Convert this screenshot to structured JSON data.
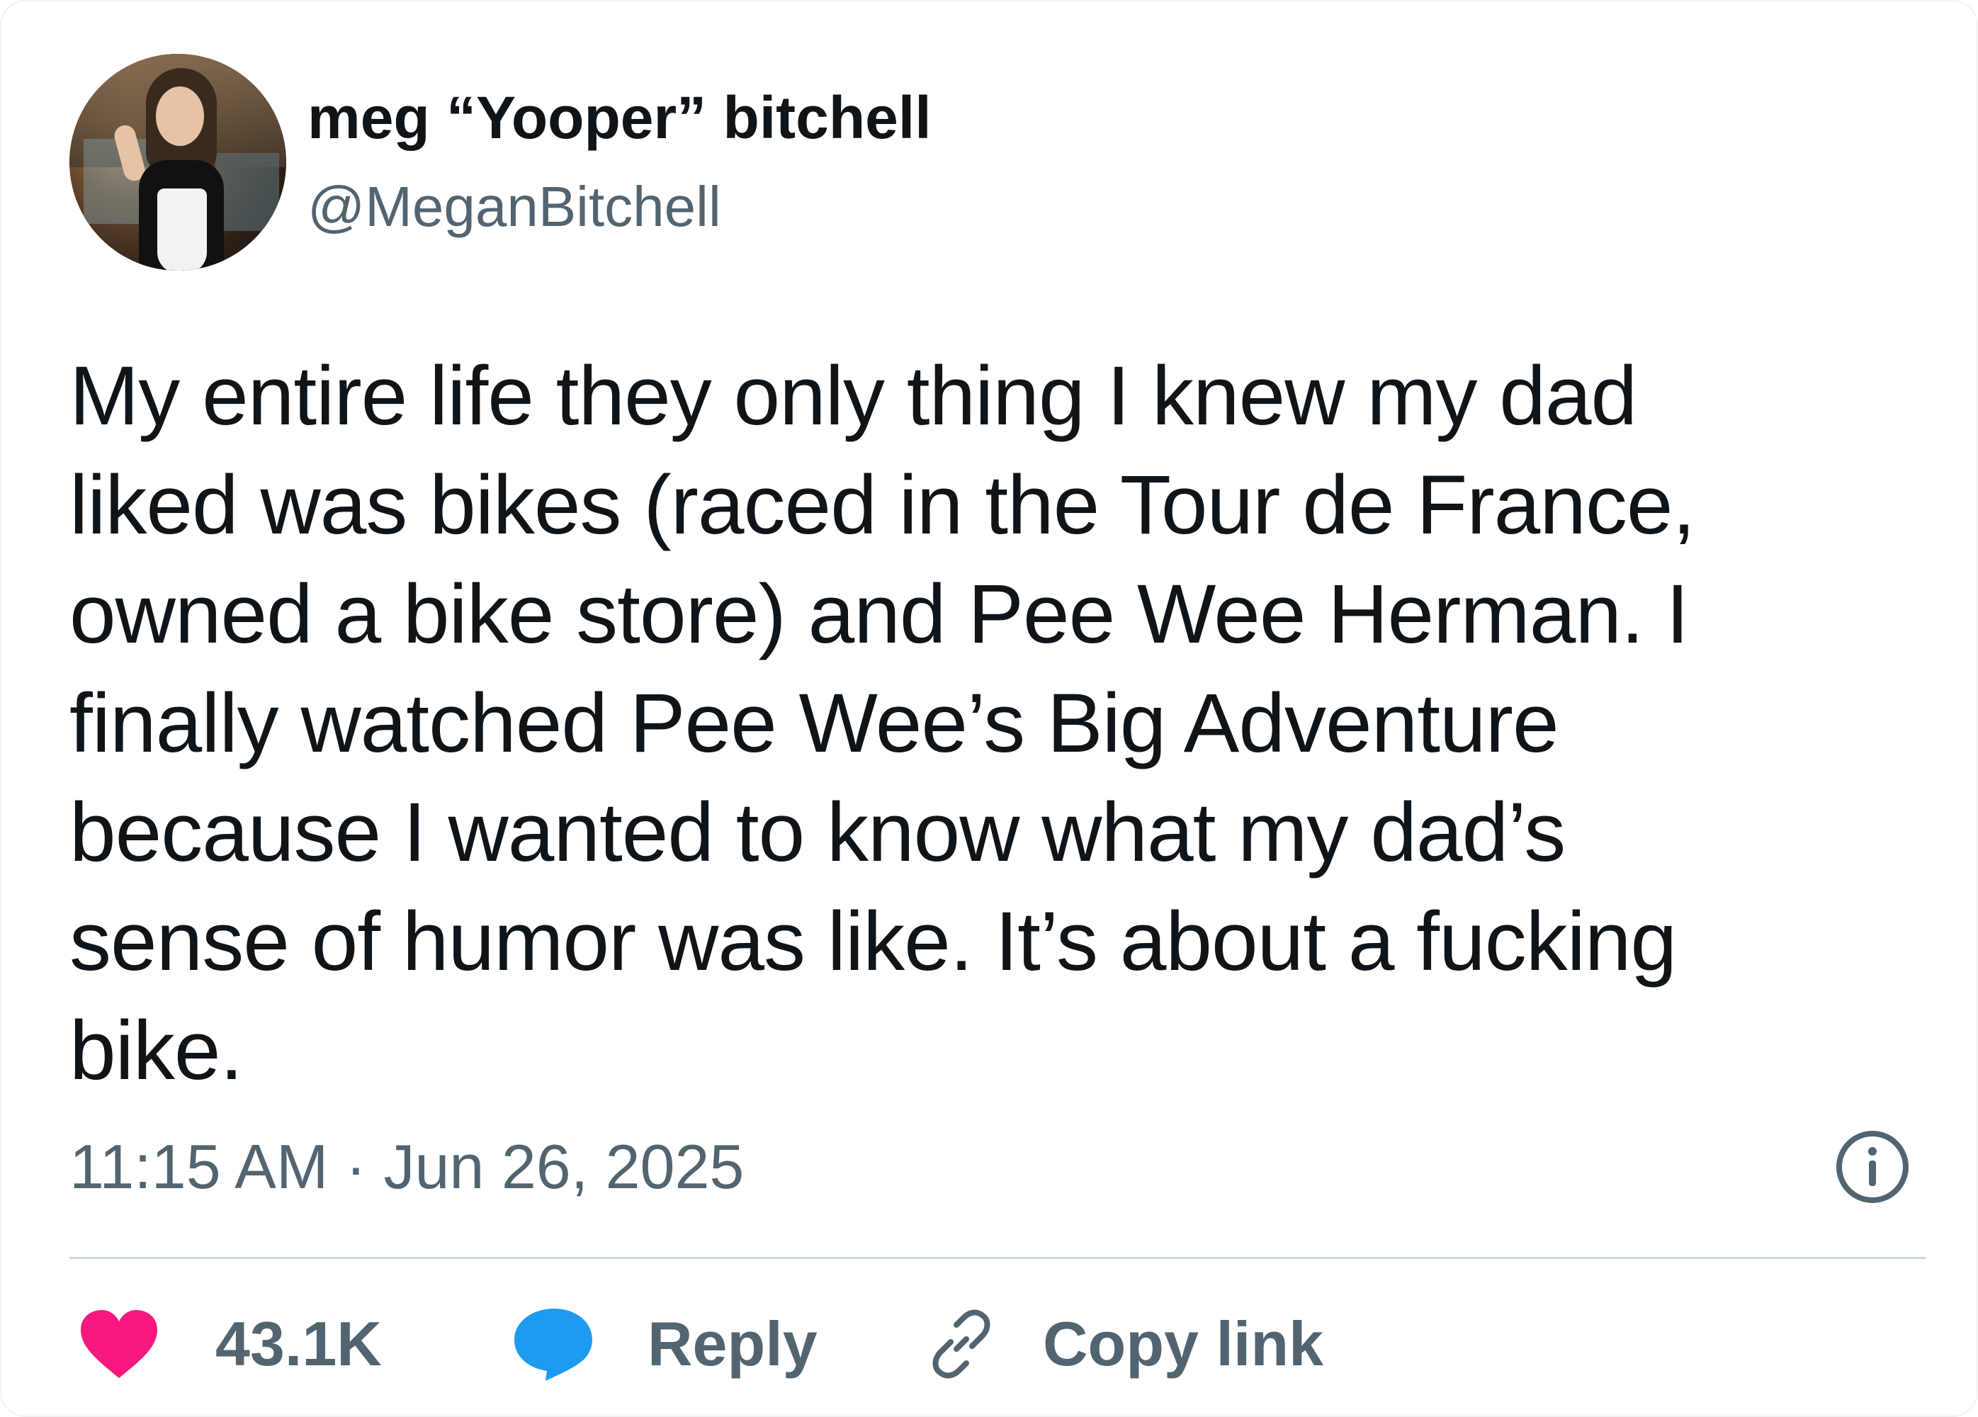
{
  "author": {
    "display_name": "meg “Yooper” bitchell",
    "handle": "@MeganBitchell"
  },
  "tweet": {
    "lines": [
      "My entire life they only thing I knew my dad",
      "liked was bikes (raced in the Tour de France,",
      "owned a bike store) and Pee Wee Herman. I",
      "finally watched Pee Wee’s Big Adventure",
      "because I wanted to know what my dad’s",
      "sense of humor was like. It’s about a fucking",
      "bike."
    ],
    "timestamp": "11:15 AM · Jun 26, 2025"
  },
  "actions": {
    "likes_count": "43.1K",
    "reply_label": "Reply",
    "copy_link_label": "Copy link"
  },
  "icons": {
    "like": "heart-icon",
    "reply": "speech-bubble-icon",
    "copy_link": "link-icon",
    "info": "info-icon"
  },
  "colors": {
    "like": "#f91880",
    "reply": "#1d9bf0",
    "secondary_text": "#536471",
    "primary_text": "#0f1419",
    "divider": "#cfd9de"
  }
}
